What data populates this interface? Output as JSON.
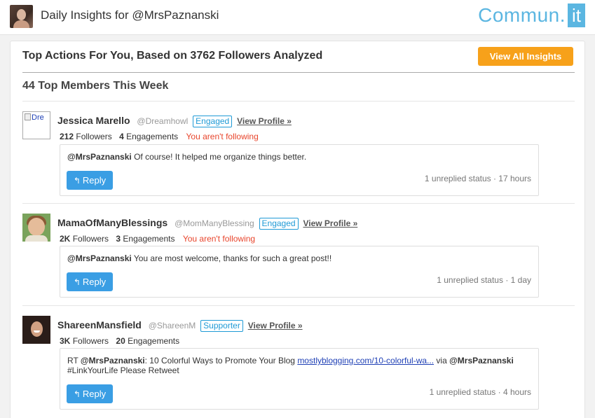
{
  "header": {
    "title": "Daily Insights for @MrsPaznanski",
    "logo_word": "Commun.",
    "logo_it": "it"
  },
  "main": {
    "title": "Top Actions For You, Based on 3762 Followers Analyzed",
    "view_all_label": "View All Insights",
    "members_title": "44 Top Members This Week"
  },
  "colors": {
    "accent": "#f7a11a",
    "reply_button": "#3a9ee4",
    "badge": "#1f9ad6",
    "not_following": "#e8452c",
    "logo": "#5bb6e1"
  },
  "members": [
    {
      "avatar_alt": "Dre",
      "name": "Jessica Marello",
      "handle": "@Dreamhowl",
      "badge": "Engaged",
      "view_profile": "View Profile »",
      "followers_count": "212",
      "followers_label": "Followers",
      "engagements_count": "4",
      "engagements_label": "Engagements",
      "follow_status": "You aren't following",
      "message_mention": "@MrsPaznanski",
      "message_text": " Of course! It helped me organize things better.",
      "reply_label": "Reply",
      "status": "1 unreplied status · 17 hours"
    },
    {
      "name": "MamaOfManyBlessings",
      "handle": "@MomManyBlessing",
      "badge": "Engaged",
      "view_profile": "View Profile »",
      "followers_count": "2K",
      "followers_label": "Followers",
      "engagements_count": "3",
      "engagements_label": "Engagements",
      "follow_status": "You aren't following",
      "message_mention": "@MrsPaznanski",
      "message_text": " You are most welcome, thanks for such a great post!!",
      "reply_label": "Reply",
      "status": "1 unreplied status · 1 day"
    },
    {
      "name": "ShareenMansfield",
      "handle": "@ShareenM",
      "badge": "Supporter",
      "view_profile": "View Profile »",
      "followers_count": "3K",
      "followers_label": "Followers",
      "engagements_count": "20",
      "engagements_label": "Engagements",
      "message_prefix": "RT ",
      "message_mention": "@MrsPaznanski",
      "message_mid": ": 10 Colorful Ways to Promote Your Blog ",
      "message_link": "mostlyblogging.com/10-colorful-wa...",
      "message_via": " via ",
      "message_mention2": "@MrsPaznanski",
      "message_tail": "#LinkYourLife Please Retweet",
      "reply_label": "Reply",
      "status": "1 unreplied status · 4 hours"
    }
  ]
}
